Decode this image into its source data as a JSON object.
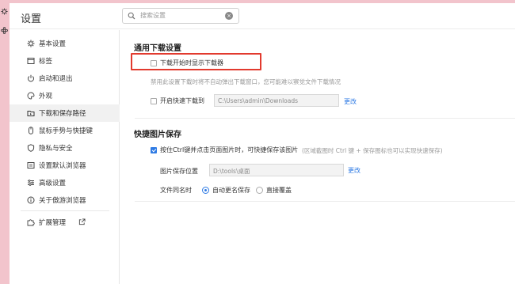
{
  "header": {
    "title": "设置",
    "search_placeholder": "搜索设置"
  },
  "sidebar": {
    "items": [
      {
        "label": "基本设置",
        "icon": "gear-icon"
      },
      {
        "label": "标签",
        "icon": "tab-icon"
      },
      {
        "label": "启动和退出",
        "icon": "power-icon"
      },
      {
        "label": "外观",
        "icon": "palette-icon"
      },
      {
        "label": "下载和保存路径",
        "icon": "download-folder-icon",
        "active": true
      },
      {
        "label": "鼠标手势与快捷键",
        "icon": "mouse-icon"
      },
      {
        "label": "隐私与安全",
        "icon": "shield-icon"
      },
      {
        "label": "设置默认浏览器",
        "icon": "browser-icon"
      },
      {
        "label": "高级设置",
        "icon": "sliders-icon"
      },
      {
        "label": "关于傲游浏览器",
        "icon": "info-icon"
      },
      {
        "label": "扩展管理",
        "icon": "puzzle-icon"
      }
    ]
  },
  "download": {
    "title": "通用下载设置",
    "show_downloader_label": "下载开始时显示下载器",
    "show_downloader_checked": false,
    "hint": "禁用此设置下载时将不自动弹出下载窗口，您可能难以察觉文件下载情况",
    "quick_download_label": "开启快速下载到",
    "quick_download_checked": false,
    "quick_download_path": "C:\\Users\\admin\\Downloads",
    "change_label": "更改"
  },
  "image_save": {
    "title": "快捷图片保存",
    "ctrl_click_label": "按住Ctrl键并点击页面图片时，可快捷保存该图片",
    "ctrl_click_hint": "(区域截图时 Ctrl 键 + 保存图标也可以实现快速保存)",
    "ctrl_click_checked": true,
    "location_label": "图片保存位置",
    "location_path": "D:\\tools\\桌面",
    "change_label": "更改",
    "same_name_label": "文件同名时",
    "options": [
      "自动更名保存",
      "直接覆盖"
    ],
    "selected_option": "自动更名保存"
  },
  "colors": {
    "accent": "#2f7be4",
    "highlight": "#e23a2e",
    "frame": "#f2c4cc"
  }
}
